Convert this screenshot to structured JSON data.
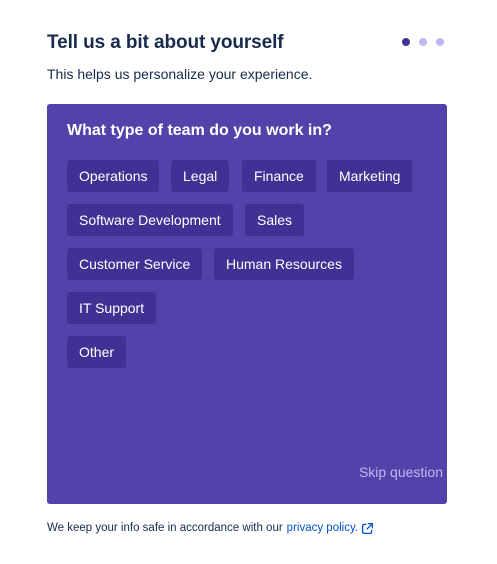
{
  "header": {
    "title": "Tell us a bit about yourself",
    "subtitle": "This helps us personalize your experience.",
    "progress": {
      "current_step": 1,
      "total_steps": 3
    }
  },
  "question": {
    "text": "What type of team do you work in?",
    "options": [
      "Operations",
      "Legal",
      "Finance",
      "Marketing",
      "Software Development",
      "Sales",
      "Customer Service",
      "Human Resources",
      "IT Support",
      "Other"
    ],
    "skip_label": "Skip question"
  },
  "footer": {
    "text": "We keep your info safe in accordance with our",
    "link_label": "privacy policy.",
    "link_icon": "external-link-icon"
  },
  "colors": {
    "card_background": "#5243aa",
    "chip_background": "#403294",
    "active_dot": "#403294",
    "inactive_dot": "#c0b6f2",
    "skip_text": "#c0b6f2",
    "link": "#0052cc",
    "text": "#172b4d"
  }
}
